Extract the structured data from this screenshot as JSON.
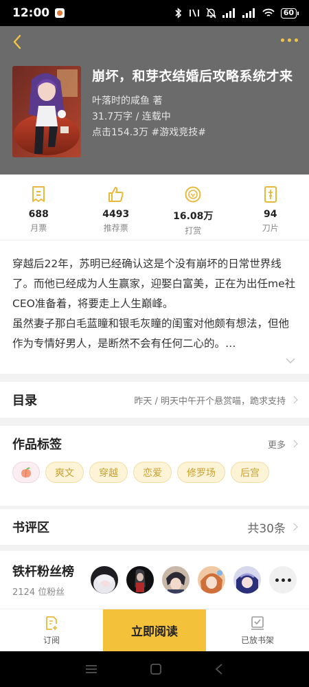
{
  "status": {
    "time": "12:00",
    "battery": "60"
  },
  "book": {
    "title": "崩坏，和芽衣结婚后攻略系统才来",
    "author": "叶落时的咸鱼  著",
    "words": "31.7万字 / 连载中",
    "clicks": "点击154.3万  #游戏竞技#"
  },
  "stats": [
    {
      "value": "688",
      "label": "月票",
      "icon": "monthly-ticket-icon"
    },
    {
      "value": "4493",
      "label": "推荐票",
      "icon": "thumbs-up-icon"
    },
    {
      "value": "16.08万",
      "label": "打赏",
      "icon": "coin-icon"
    },
    {
      "value": "94",
      "label": "刀片",
      "icon": "blade-card-icon"
    }
  ],
  "synopsis": {
    "p1": "穿越后22年，苏明已经确认这是个没有崩坏的日常世界线了。而他已经成为人生赢家，迎娶白富美，正在为出任me社CEO准备着，将要走上人生巅峰。",
    "p2": "虽然妻子那白毛蓝瞳和银毛灰瞳的闺蜜对他颇有想法，但他作为专情好男人，是断然不会有任何二心的。…"
  },
  "catalog": {
    "title": "目录",
    "latest": "昨天 / 明天中午开个悬赏喵，跪求支持"
  },
  "tags_section": {
    "title": "作品标签",
    "more": "更多"
  },
  "tags": [
    "爽文",
    "穿越",
    "恋爱",
    "修罗场",
    "后宫"
  ],
  "reviews": {
    "title": "书评区",
    "count": "共30条"
  },
  "fans": {
    "title": "铁杆粉丝榜",
    "count": "2124 位粉丝"
  },
  "bottom": {
    "subscribe": "订阅",
    "read": "立即阅读",
    "shelf": "已放书架"
  },
  "colors": {
    "accent": "#f3c13a",
    "header_bg": "#6b6b6b"
  }
}
